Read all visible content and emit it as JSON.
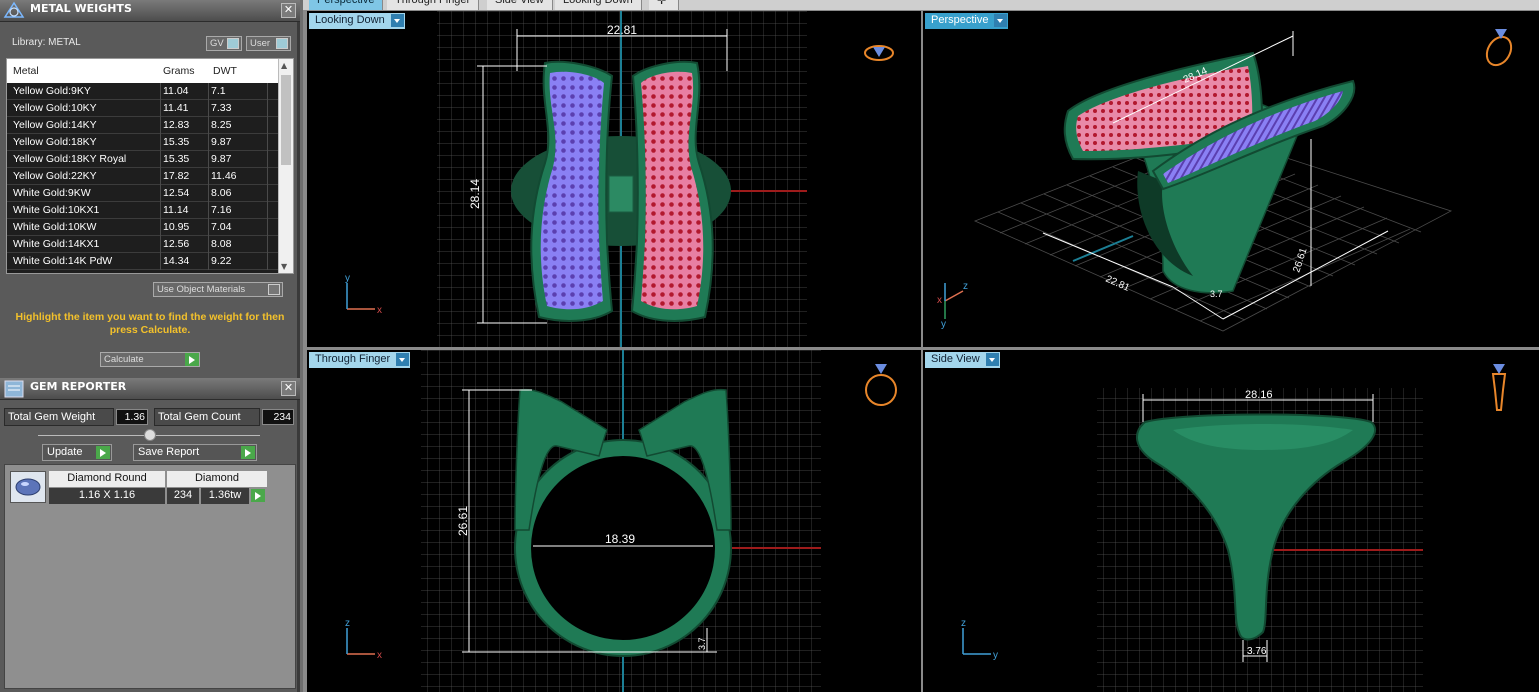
{
  "metal_weights": {
    "title": "METAL WEIGHTS",
    "library_label": "Library: METAL",
    "gv_label": "GV",
    "user_label": "User",
    "columns": [
      "Metal",
      "Grams",
      "DWT"
    ],
    "rows": [
      {
        "metal": "Yellow Gold:9KY",
        "grams": "11.04",
        "dwt": "7.1"
      },
      {
        "metal": "Yellow Gold:10KY",
        "grams": "11.41",
        "dwt": "7.33"
      },
      {
        "metal": "Yellow Gold:14KY",
        "grams": "12.83",
        "dwt": "8.25"
      },
      {
        "metal": "Yellow Gold:18KY",
        "grams": "15.35",
        "dwt": "9.87"
      },
      {
        "metal": "Yellow Gold:18KY Royal",
        "grams": "15.35",
        "dwt": "9.87"
      },
      {
        "metal": "Yellow Gold:22KY",
        "grams": "17.82",
        "dwt": "11.46"
      },
      {
        "metal": "White Gold:9KW",
        "grams": "12.54",
        "dwt": "8.06"
      },
      {
        "metal": "White Gold:10KX1",
        "grams": "11.14",
        "dwt": "7.16"
      },
      {
        "metal": "White Gold:10KW",
        "grams": "10.95",
        "dwt": "7.04"
      },
      {
        "metal": "White Gold:14KX1",
        "grams": "12.56",
        "dwt": "8.08"
      },
      {
        "metal": "White Gold:14K PdW",
        "grams": "14.34",
        "dwt": "9.22"
      }
    ],
    "use_object_materials": "Use Object Materials",
    "hint": "Highlight the item you want to find the weight for then press Calculate.",
    "calculate_label": "Calculate"
  },
  "gem_reporter": {
    "title": "GEM REPORTER",
    "total_weight_label": "Total Gem Weight",
    "total_weight_value": "1.36",
    "total_count_label": "Total Gem Count",
    "total_count_value": "234",
    "update_label": "Update",
    "save_report_label": "Save Report",
    "gem": {
      "shape": "Diamond Round",
      "material": "Diamond",
      "size": "1.16 X 1.16",
      "count": "234",
      "weight": "1.36tw"
    }
  },
  "tabs": [
    "Perspective",
    "Through Finger",
    "Side View",
    "Looking Down"
  ],
  "viewports": {
    "top_left": {
      "label": "Looking Down",
      "dim_width": "22.81",
      "dim_height": "28.14",
      "axis_a": "y",
      "axis_b": "x"
    },
    "top_right": {
      "label": "Perspective",
      "dim_a": "22.81",
      "dim_b": "28.14",
      "dim_c": "26.61",
      "dim_d": "3.7",
      "dim_e": "22.81",
      "axis_a": "z",
      "axis_b": "x",
      "axis_c": "y"
    },
    "bottom_left": {
      "label": "Through Finger",
      "dim_height": "26.61",
      "dim_inner": "18.39",
      "dim_shank": "3.7",
      "axis_a": "z",
      "axis_b": "x"
    },
    "bottom_right": {
      "label": "Side View",
      "dim_width": "28.16",
      "dim_bottom": "3.76",
      "axis_a": "z",
      "axis_b": "y"
    }
  },
  "colors": {
    "metal_green": "#1f6e4b",
    "gems_blue": "#7b6ff0",
    "gems_red": "#e05577",
    "panel_bg": "#5a5a5a",
    "active_tab": "#38a0cc",
    "hint_text": "#f3c12b"
  }
}
